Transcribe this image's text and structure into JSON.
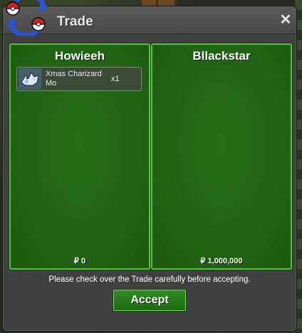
{
  "window": {
    "title": "Trade",
    "close_symbol": "✕"
  },
  "left_trader": {
    "name": "Howieeh",
    "items": [
      {
        "name": "Xmas Charizard Mo",
        "quantity": "x1",
        "icon": "charizard-sprite-icon"
      }
    ],
    "money": "₽ 0"
  },
  "right_trader": {
    "name": "Bllackstar",
    "items": [],
    "money": "₽ 1,000,000"
  },
  "notice": "Please check over the Trade carefully before accepting.",
  "accept_label": "Accept",
  "colors": {
    "panel_green": "#1f6012",
    "panel_border": "#58c240",
    "window_gray": "#404040",
    "titlebar_gray": "#525252"
  }
}
